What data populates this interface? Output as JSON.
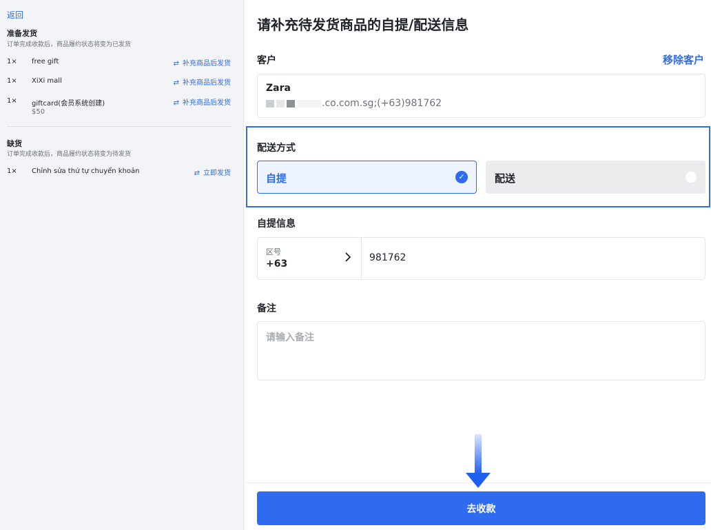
{
  "left_panel": {
    "back_label": "返回",
    "ready": {
      "title": "准备发货",
      "subtitle": "订单完成收款后，商品履约状态将变为已发货",
      "items": [
        {
          "qty": "1×",
          "name": "free gift",
          "action": "补充商品后发货"
        },
        {
          "qty": "1×",
          "name": "XiXi mall",
          "action": "补充商品后发货"
        },
        {
          "qty": "1×",
          "name": "giftcard(会员系统创建)",
          "sub": "$50",
          "action": "补充商品后发货"
        }
      ]
    },
    "shortage": {
      "title": "缺货",
      "subtitle": "订单完成收款后，商品履约状态将变为待发货",
      "items": [
        {
          "qty": "1×",
          "name": "Chỉnh sửa thứ tự chuyển khoản",
          "action": "立即发货"
        }
      ]
    },
    "swap_icon": "⇄"
  },
  "main": {
    "title": "请补充待发货商品的自提/配送信息",
    "customer": {
      "label": "客户",
      "remove_label": "移除客户",
      "name": "Zara",
      "contact": ".co.com.sg;(+63)981762"
    },
    "shipping": {
      "label": "配送方式",
      "options": [
        {
          "label": "自提",
          "selected": true
        },
        {
          "label": "配送",
          "selected": false
        }
      ]
    },
    "pickup": {
      "label": "自提信息",
      "area_label": "区号",
      "area_code": "+63",
      "phone": "981762"
    },
    "note": {
      "label": "备注",
      "placeholder": "请输入备注"
    },
    "pay_button": "去收款"
  },
  "colors": {
    "accent": "#2f6bef",
    "left_bg": "#f2f4f8",
    "selected_bg": "#eef4ff",
    "unselected_bg": "#ebecee"
  }
}
